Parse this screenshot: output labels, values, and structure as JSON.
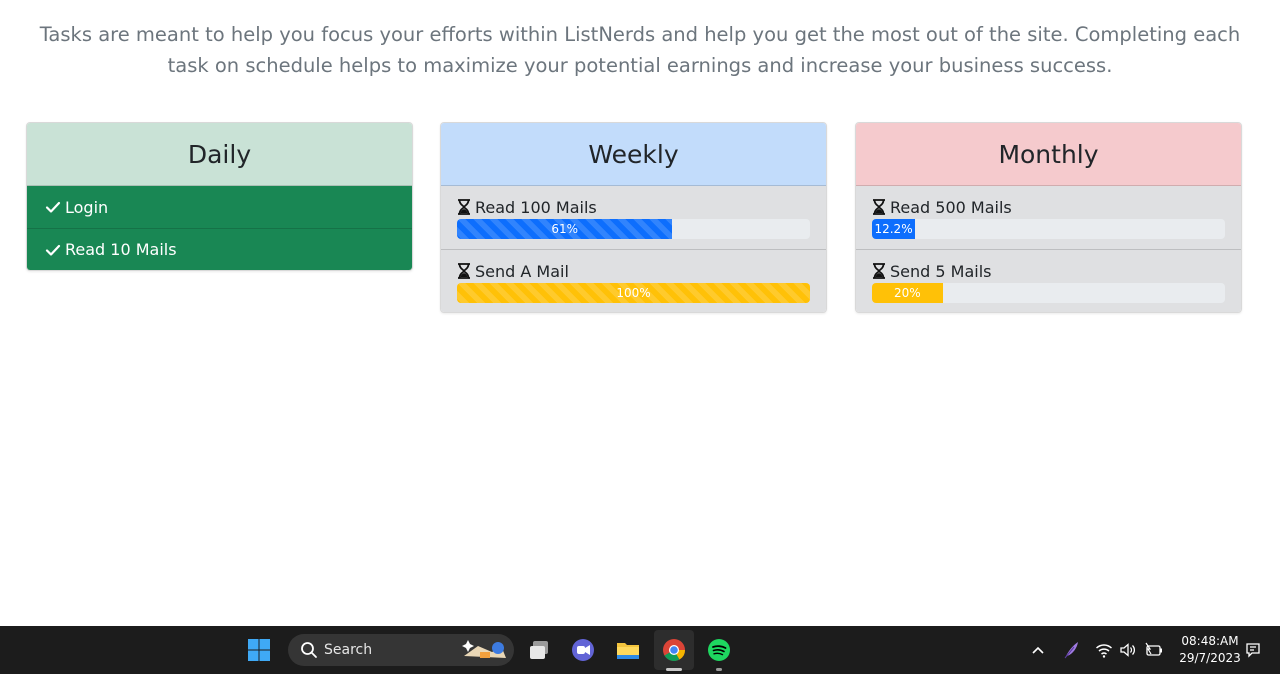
{
  "intro_text": "Tasks are meant to help you focus your efforts within ListNerds and help you get the most out of the site. Completing each task on schedule helps to maximize your potential earnings and increase your business success.",
  "daily": {
    "title": "Daily",
    "items": [
      {
        "label": "Login",
        "icon": "check-icon"
      },
      {
        "label": "Read 10 Mails",
        "icon": "check-icon"
      }
    ]
  },
  "weekly": {
    "title": "Weekly",
    "items": [
      {
        "label": "Read 100 Mails",
        "icon": "hourglass-icon",
        "progress": 61,
        "progress_label": "61%",
        "color": "#0d6efd"
      },
      {
        "label": "Send A Mail",
        "icon": "hourglass-icon",
        "progress": 100,
        "progress_label": "100%",
        "color": "#ffc107"
      }
    ]
  },
  "monthly": {
    "title": "Monthly",
    "items": [
      {
        "label": "Read 500 Mails",
        "icon": "hourglass-icon",
        "progress": 12.2,
        "progress_label": "12.2%",
        "color": "#0d6efd"
      },
      {
        "label": "Send 5 Mails",
        "icon": "hourglass-icon",
        "progress": 20,
        "progress_label": "20%",
        "color": "#ffc107"
      }
    ]
  },
  "colors": {
    "daily_header": "#c9e2d6",
    "weekly_header": "#c2dcfb",
    "monthly_header": "#f5cacd",
    "done_item": "#198754",
    "task_item": "#dfe0e2"
  },
  "taskbar": {
    "search_label": "Search",
    "time": "08:48:AM",
    "date": "29/7/2023",
    "icons": [
      "windows-start-icon",
      "search-icon",
      "task-view-icon",
      "teams-chat-icon",
      "file-explorer-icon",
      "chrome-icon",
      "spotify-icon",
      "chevron-up-icon",
      "feather-icon",
      "wifi-icon",
      "volume-icon",
      "battery-icon",
      "notification-icon"
    ]
  }
}
